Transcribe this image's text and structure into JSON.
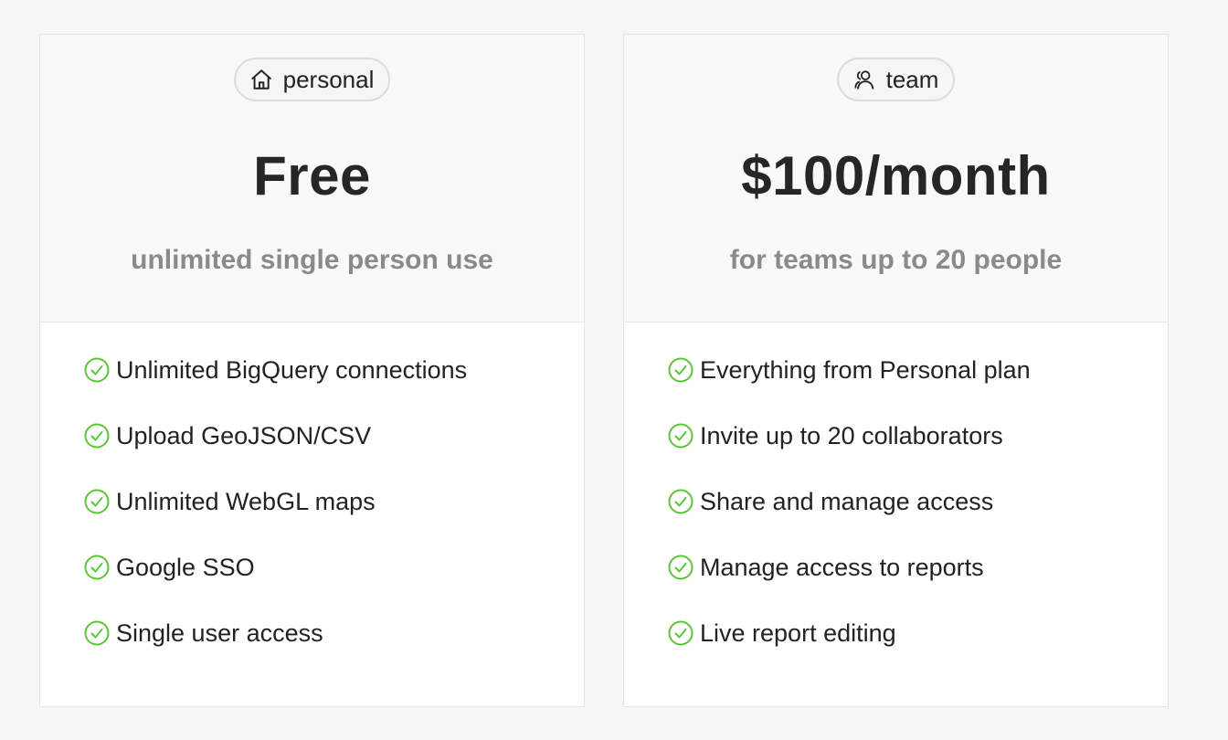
{
  "colors": {
    "check": "#5cc43b",
    "price": "#262626",
    "subtitle": "#8a8a8a",
    "page_background": "#f6f6f6"
  },
  "plans": [
    {
      "badge": {
        "icon": "home-icon",
        "label": "personal"
      },
      "price": "Free",
      "subtitle": "unlimited single person use",
      "features": [
        "Unlimited BigQuery connections",
        "Upload GeoJSON/CSV",
        "Unlimited WebGL maps",
        "Google SSO",
        "Single user access"
      ]
    },
    {
      "badge": {
        "icon": "users-icon",
        "label": "team"
      },
      "price": "$100/month",
      "subtitle": "for teams up to 20 people",
      "features": [
        "Everything from Personal plan",
        "Invite up to 20 collaborators",
        "Share and manage access",
        "Manage access to reports",
        "Live report editing"
      ]
    }
  ]
}
